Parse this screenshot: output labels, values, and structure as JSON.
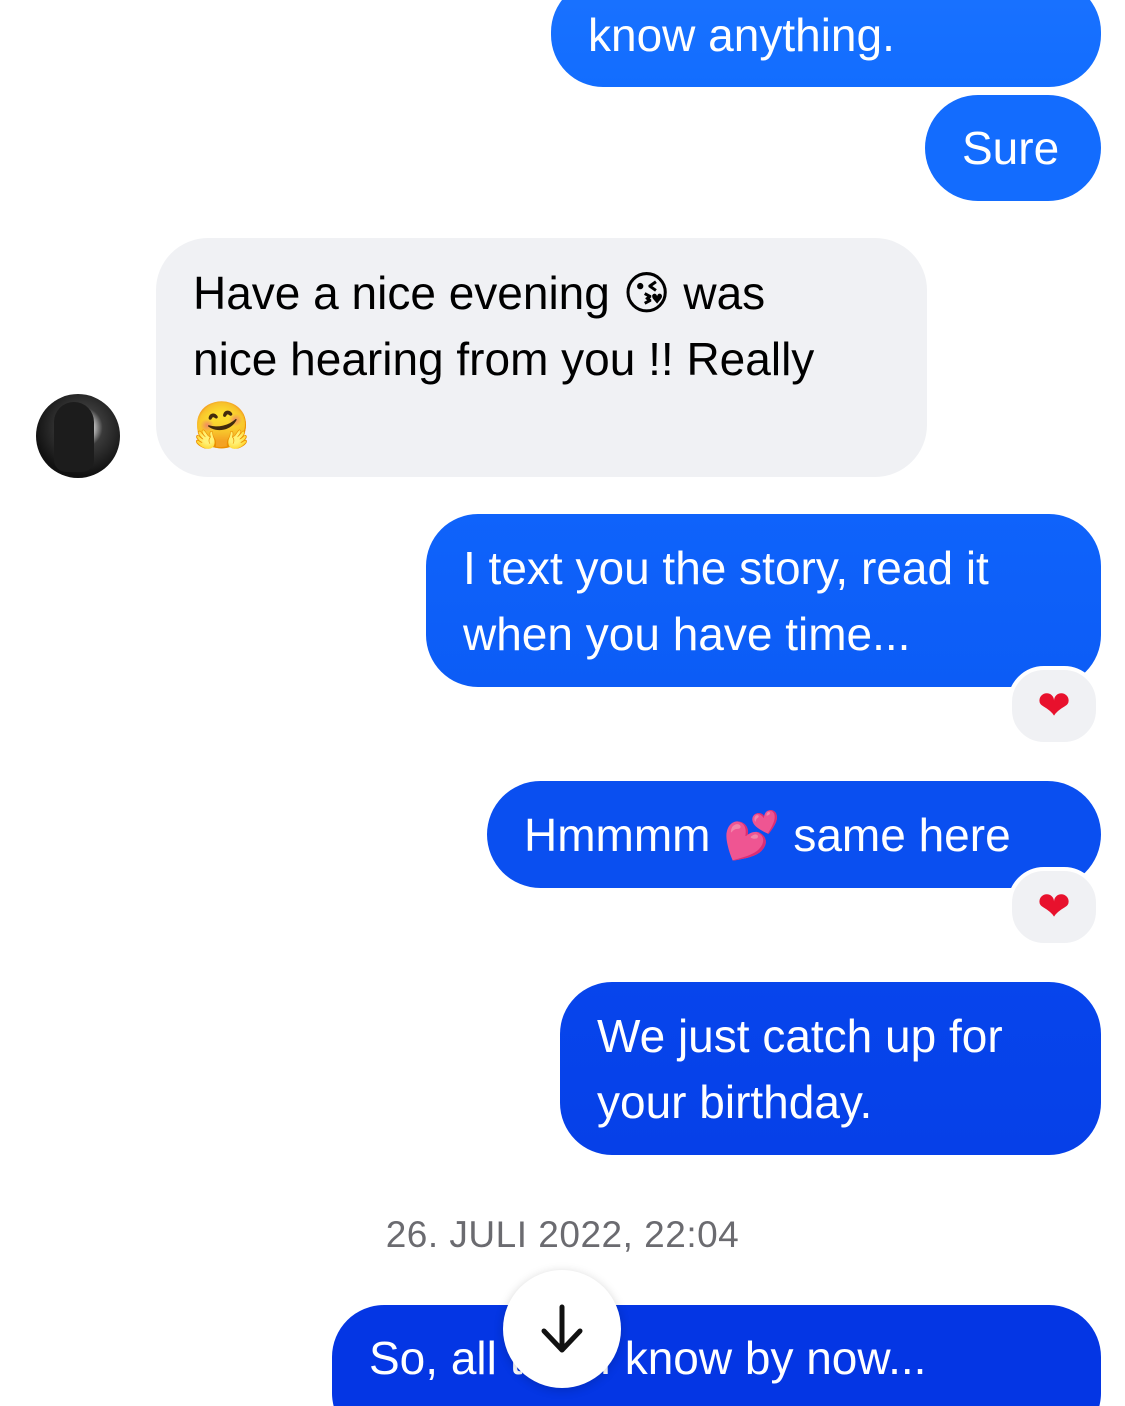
{
  "messages": {
    "m1": "know anything.",
    "m2": "Sure",
    "m3": "Have a nice evening 😘 was\nnice hearing from you !! Really\n🤗",
    "m4": "I text you the story, read it\nwhen you have time...",
    "m5": "Hmmmm 💕 same here",
    "m6": "We just catch up for\nyour birthday.",
    "m7": "So, all that I know by now..."
  },
  "reactions": {
    "r1": "❤",
    "r2": "❤"
  },
  "timestamp": "26. JULI 2022, 22:04",
  "icons": {
    "avatar": "contact-avatar",
    "scroll": "arrow-down-icon"
  }
}
